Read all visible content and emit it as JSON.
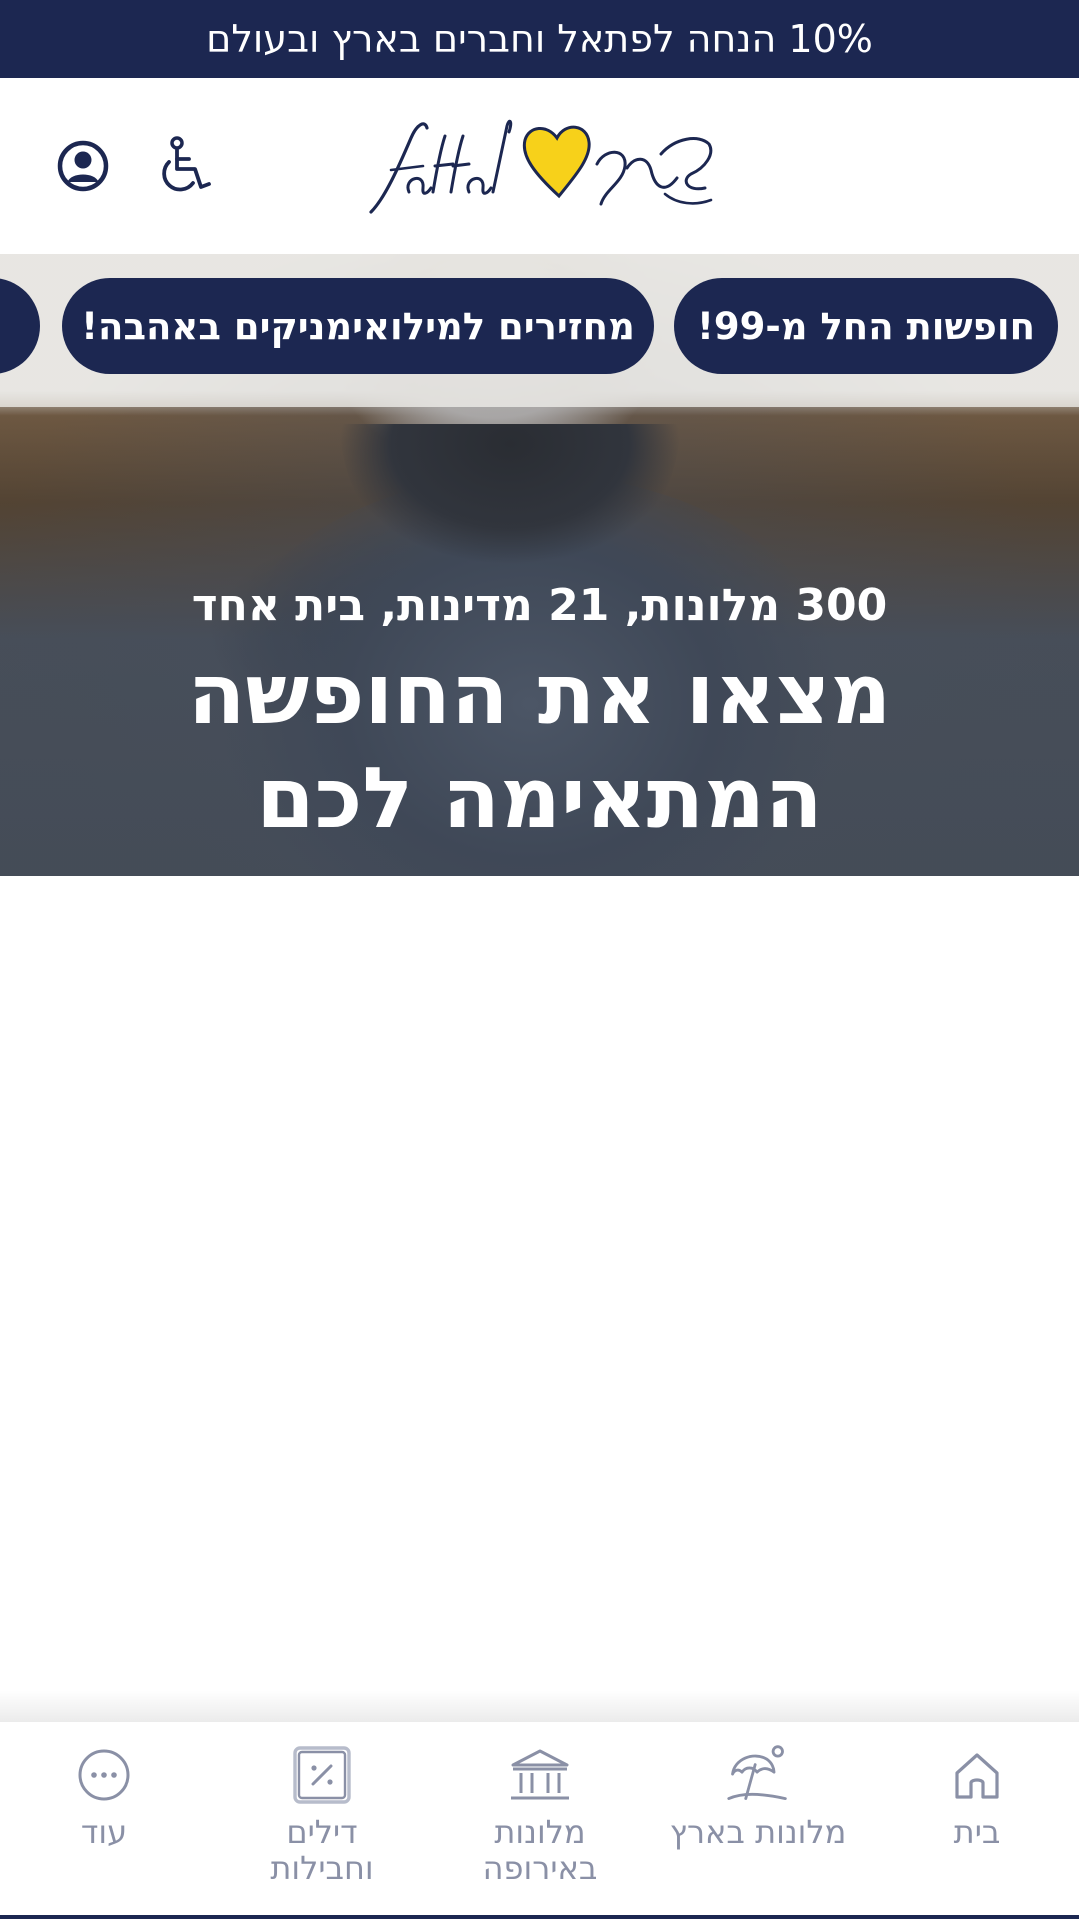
{
  "promo_bar": {
    "text": "10% הנחה לפתאל וחברים בארץ ובעולם"
  },
  "header": {
    "logo_text": "fattal",
    "logo_alt_text": "פתאל"
  },
  "campaign_buttons": [
    {
      "label": "חופשות החל מ-99!"
    },
    {
      "label": "מחזירים למילואימניקים באהבה!"
    }
  ],
  "hero": {
    "subtitle": "300 מלונות, 21 מדינות, בית אחד",
    "title_line1": "מצאו את החופשה",
    "title_line2": "המתאימה לכם"
  },
  "bottom_nav": {
    "items": [
      {
        "label": "בית",
        "icon": "home-icon"
      },
      {
        "label": "מלונות בארץ",
        "icon": "beach-umbrella-icon"
      },
      {
        "label_line1": "מלונות",
        "label_line2": "באירופה",
        "icon": "museum-icon"
      },
      {
        "label_line1": "דילים",
        "label_line2": "וחבילות",
        "icon": "discount-icon"
      },
      {
        "label": "עוד",
        "icon": "more-dots-icon"
      }
    ]
  },
  "colors": {
    "brand_navy": "#1c2751",
    "brand_yellow": "#f7d11a",
    "nav_gray": "#8a90a6"
  }
}
